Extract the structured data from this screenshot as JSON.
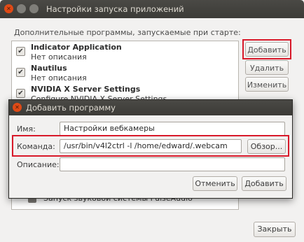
{
  "window": {
    "title": "Настройки запуска приложений",
    "section_label": "Дополнительные программы, запускаемые при старте:",
    "items": [
      {
        "name": "Indicator Application",
        "desc": "Нет описания",
        "checked": true
      },
      {
        "name": "Nautilus",
        "desc": "Нет описания",
        "checked": true
      },
      {
        "name": "NVIDIA X Server Settings",
        "desc": "Configure NVIDIA X Server Settings",
        "checked": true
      }
    ],
    "hidden_item_text": "Запуск звуковой системы PulseAudio",
    "buttons": {
      "add": "Добавить",
      "remove": "Удалить",
      "edit": "Изменить",
      "close": "Закрыть"
    }
  },
  "dialog": {
    "title": "Добавить программу",
    "name_label": "Имя:",
    "name_value": "Настройки вебкамеры",
    "command_label": "Команда:",
    "command_value": "/usr/bin/v4l2ctrl -l /home/edward/.webcam",
    "browse_label": "Обзор...",
    "description_label": "Описание:",
    "description_value": "",
    "cancel_label": "Отменить",
    "add_label": "Добавить"
  },
  "colors": {
    "highlight": "#d8192a",
    "titlebar": "#3c3b37",
    "close_button": "#df4a16",
    "window_bg": "#f2f1f0"
  }
}
